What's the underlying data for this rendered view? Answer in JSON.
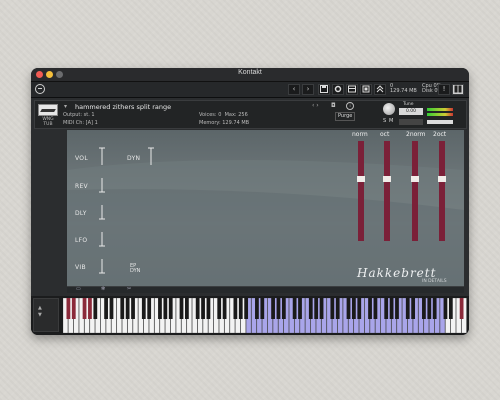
{
  "window": {
    "title": "Kontakt"
  },
  "toolbar": {
    "buttons": [
      "‹",
      "›",
      "save-icon",
      "gear-icon",
      "panels-icon",
      "library-icon",
      "expand-icon",
      "!",
      "browser-icon"
    ],
    "cpu_label": "Cpu",
    "cpu_value": "0%",
    "disk_label": "Disk",
    "disk_value": "0%",
    "voices_value": "0",
    "memory_value": "129.74 MB"
  },
  "instrument": {
    "wrench_label": "WNG\nTUB",
    "name": "hammered zithers split range",
    "output_label": "Output:",
    "output_value": "st. 1",
    "voices_label": "Voices:",
    "voices_value": "0",
    "max_label": "Max:",
    "max_value": "256",
    "purge_label": "Purge",
    "midi_label": "MIDI Ch:",
    "midi_value": "[A]  1",
    "memory_label": "Memory:",
    "memory_value": "129.74 MB",
    "tune_label": "Tune",
    "tune_value": "0.00",
    "s_label": "S",
    "m_label": "M"
  },
  "controls": {
    "left": [
      "VOL",
      "REV",
      "DLY",
      "LFO",
      "VIB"
    ],
    "dyn": "DYN",
    "ep_label": "EP\nDYN",
    "fader_headers": [
      "norm",
      "oct",
      "2norm",
      "2oct"
    ],
    "fader_levels": [
      0.45,
      0.45,
      0.45,
      0.45
    ],
    "brand": "Hakkebrett",
    "credit": "IN DETAILS"
  },
  "colors": {
    "fader_red": "#7b2038",
    "handle": "#f1ece9",
    "keyboard_highlight": "#a9a5ea",
    "keyswitch_red": "#8b2a3a"
  },
  "keyboard": {
    "octave_icons": [
      "up-arrow-icon",
      "down-arrow-icon"
    ],
    "white_key_count": 75,
    "keyswitch_ranges": [
      [
        0,
        5
      ],
      [
        72,
        75
      ]
    ],
    "highlight_range": [
      34,
      71
    ]
  }
}
